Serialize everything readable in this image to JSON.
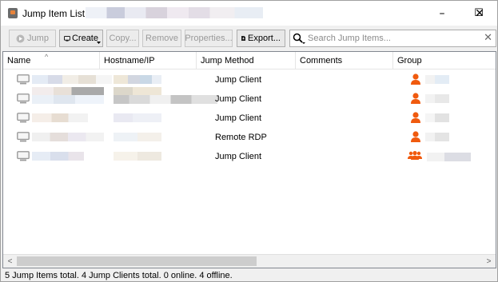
{
  "window": {
    "title": "Jump Item List -",
    "controls": {
      "minimize": "–",
      "maximize": "☐",
      "close": "✕"
    }
  },
  "toolbar": {
    "jump_label": "Jump",
    "create_label": "Create",
    "copy_label": "Copy...",
    "remove_label": "Remove",
    "properties_label": "Properties...",
    "export_label": "Export...",
    "search_placeholder": "Search Jump Items...",
    "clear_icon": "✕"
  },
  "table": {
    "columns": [
      "Name",
      "Hostname/IP",
      "Jump Method",
      "Comments",
      "Group"
    ],
    "rows": [
      {
        "jump_method": "Jump Client",
        "group_icon": "user-icon"
      },
      {
        "jump_method": "Jump Client",
        "group_icon": "user-icon"
      },
      {
        "jump_method": "Jump Client",
        "group_icon": "user-icon"
      },
      {
        "jump_method": "Remote RDP",
        "group_icon": "user-icon"
      },
      {
        "jump_method": "Jump Client",
        "group_icon": "group-icon"
      }
    ]
  },
  "status": {
    "text": "5 Jump Items total.  4 Jump Clients total.  0 online.  4 offline."
  },
  "colors": {
    "accent": "#f05a0e"
  }
}
